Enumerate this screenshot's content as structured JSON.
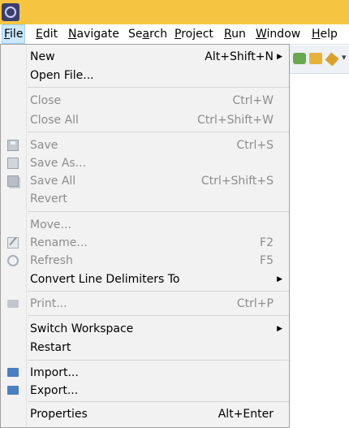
{
  "menubar": {
    "items": [
      {
        "pre": "",
        "mn": "F",
        "post": "ile"
      },
      {
        "pre": "",
        "mn": "E",
        "post": "dit"
      },
      {
        "pre": "",
        "mn": "N",
        "post": "avigate"
      },
      {
        "pre": "Se",
        "mn": "a",
        "post": "rch"
      },
      {
        "pre": "",
        "mn": "P",
        "post": "roject"
      },
      {
        "pre": "",
        "mn": "R",
        "post": "un"
      },
      {
        "pre": "",
        "mn": "W",
        "post": "indow"
      },
      {
        "pre": "",
        "mn": "H",
        "post": "elp"
      }
    ]
  },
  "file_menu": {
    "items": [
      {
        "label": "New",
        "accel": "Alt+Shift+N",
        "submenu": "▶",
        "enabled": true
      },
      {
        "label": "Open File...",
        "accel": "",
        "enabled": true
      },
      {
        "label": "Close",
        "accel": "Ctrl+W",
        "enabled": false
      },
      {
        "label": "Close All",
        "accel": "Ctrl+Shift+W",
        "enabled": false
      },
      {
        "label": "Save",
        "accel": "Ctrl+S",
        "enabled": false
      },
      {
        "label": "Save As...",
        "accel": "",
        "enabled": false
      },
      {
        "label": "Save All",
        "accel": "Ctrl+Shift+S",
        "enabled": false
      },
      {
        "label": "Revert",
        "accel": "",
        "enabled": false
      },
      {
        "label": "Move...",
        "accel": "",
        "enabled": false
      },
      {
        "label": "Rename...",
        "accel": "F2",
        "enabled": false
      },
      {
        "label": "Refresh",
        "accel": "F5",
        "enabled": false
      },
      {
        "label": "Convert Line Delimiters To",
        "accel": "",
        "submenu": "▶",
        "enabled": true
      },
      {
        "label": "Print...",
        "accel": "Ctrl+P",
        "enabled": false
      },
      {
        "label": "Switch Workspace",
        "accel": "",
        "submenu": "▶",
        "enabled": true
      },
      {
        "label": "Restart",
        "accel": "",
        "enabled": true
      },
      {
        "label": "Import...",
        "accel": "",
        "enabled": true
      },
      {
        "label": "Export...",
        "accel": "",
        "enabled": true
      },
      {
        "label": "Properties",
        "accel": "Alt+Enter",
        "enabled": true
      }
    ]
  }
}
